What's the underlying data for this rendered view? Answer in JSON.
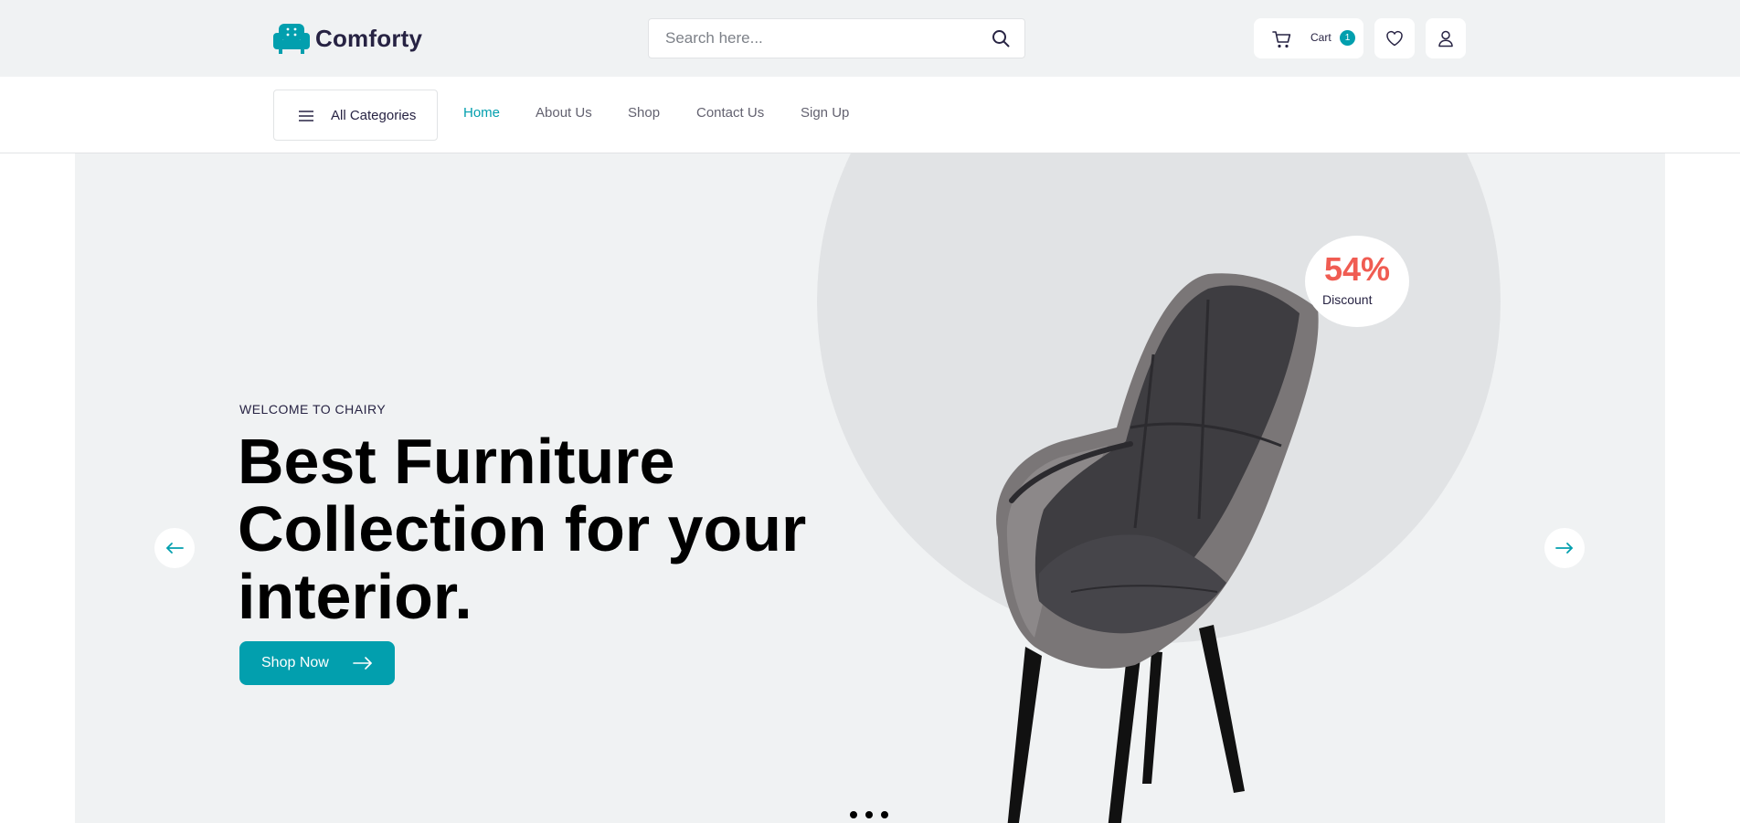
{
  "brand": {
    "name": "Comforty",
    "accent_color": "#029fae",
    "logo_icon": "armchair-logo-icon"
  },
  "search": {
    "placeholder": "Search here...",
    "value": "",
    "icon": "search-icon"
  },
  "header_actions": {
    "cart": {
      "label": "Cart",
      "count": "1",
      "icon": "cart-icon"
    },
    "wishlist": {
      "icon": "heart-icon"
    },
    "account": {
      "icon": "user-icon"
    }
  },
  "nav": {
    "categories_label": "All Categories",
    "links": [
      {
        "label": "Home",
        "active": true
      },
      {
        "label": "About Us",
        "active": false
      },
      {
        "label": "Shop",
        "active": false
      },
      {
        "label": "Contact Us",
        "active": false
      },
      {
        "label": "Sign Up",
        "active": false
      }
    ]
  },
  "hero": {
    "eyebrow": "WELCOME TO CHAIRY",
    "headline_lines": [
      "Best Furniture",
      "Collection for your",
      "interior."
    ],
    "cta_label": "Shop Now",
    "discount": {
      "percent": "54%",
      "label": "Discount",
      "color": "#f05c52"
    },
    "slides_total": 3,
    "prev_icon": "arrow-left-icon",
    "next_icon": "arrow-right-icon"
  }
}
